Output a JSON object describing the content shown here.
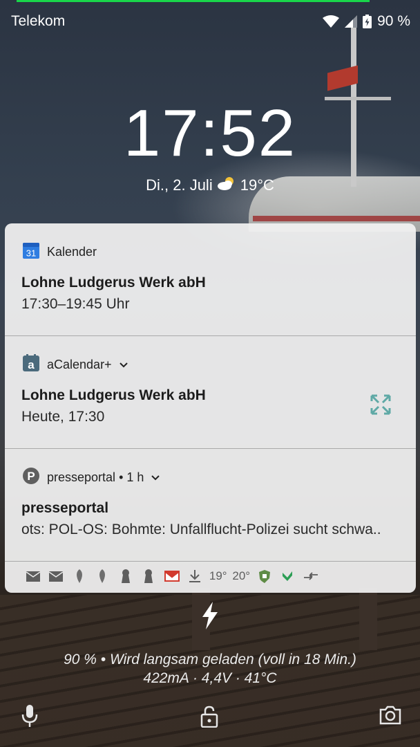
{
  "status_bar": {
    "carrier": "Telekom",
    "battery_percent": "90 %",
    "charge_progress": 0.9,
    "accent_color": "#19d64a"
  },
  "lockscreen": {
    "time": "17:52",
    "date": "Di., 2. Juli",
    "temperature": "19°C",
    "weather_icon": "partly-cloudy-icon"
  },
  "notifications": [
    {
      "app": "Kalender",
      "app_icon": "google-calendar-icon",
      "app_icon_text": "31",
      "title": "Lohne Ludgerus Werk abH",
      "text": "17:30–19:45 Uhr"
    },
    {
      "app": "aCalendar+",
      "app_icon": "acalendar-icon",
      "app_icon_text": "a",
      "title": "Lohne Ludgerus Werk abH",
      "text": "Heute, 17:30",
      "side_icon": "exchange-icon"
    },
    {
      "app": "presseportal",
      "app_icon": "presseportal-icon",
      "app_icon_text": "P",
      "meta": " • 1 h",
      "title": "presseportal",
      "text": "ots: POL-OS: Bohmte: Unfallflucht-Polizei sucht schwa.."
    }
  ],
  "overflow_icons": {
    "temp_1": "19°",
    "temp_2": "20°"
  },
  "charging": {
    "line1": "90 % • Wird langsam geladen (voll in 18 Min.)",
    "line2": "422mA · 4,4V · 41°C"
  }
}
